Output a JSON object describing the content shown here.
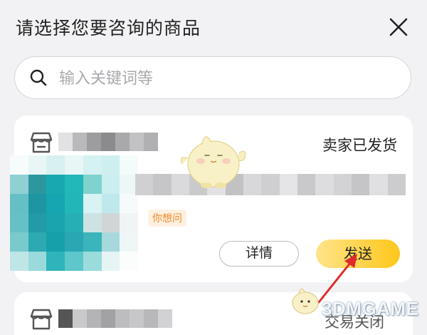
{
  "header": {
    "title": "请选择您要咨询的商品"
  },
  "search": {
    "placeholder": "输入关键词等"
  },
  "orders": [
    {
      "status": "卖家已发货",
      "tag": "你想问",
      "buttons": {
        "detail": "详情",
        "send": "发送"
      }
    },
    {
      "status": "交易关闭"
    }
  ],
  "icons": [
    "close-icon",
    "search-icon",
    "shop-icon"
  ],
  "colors": {
    "send_button": "#ffc71a",
    "tag_text": "#f08a2c",
    "background": "#f2f2f4"
  },
  "watermark": "3DMGAME"
}
